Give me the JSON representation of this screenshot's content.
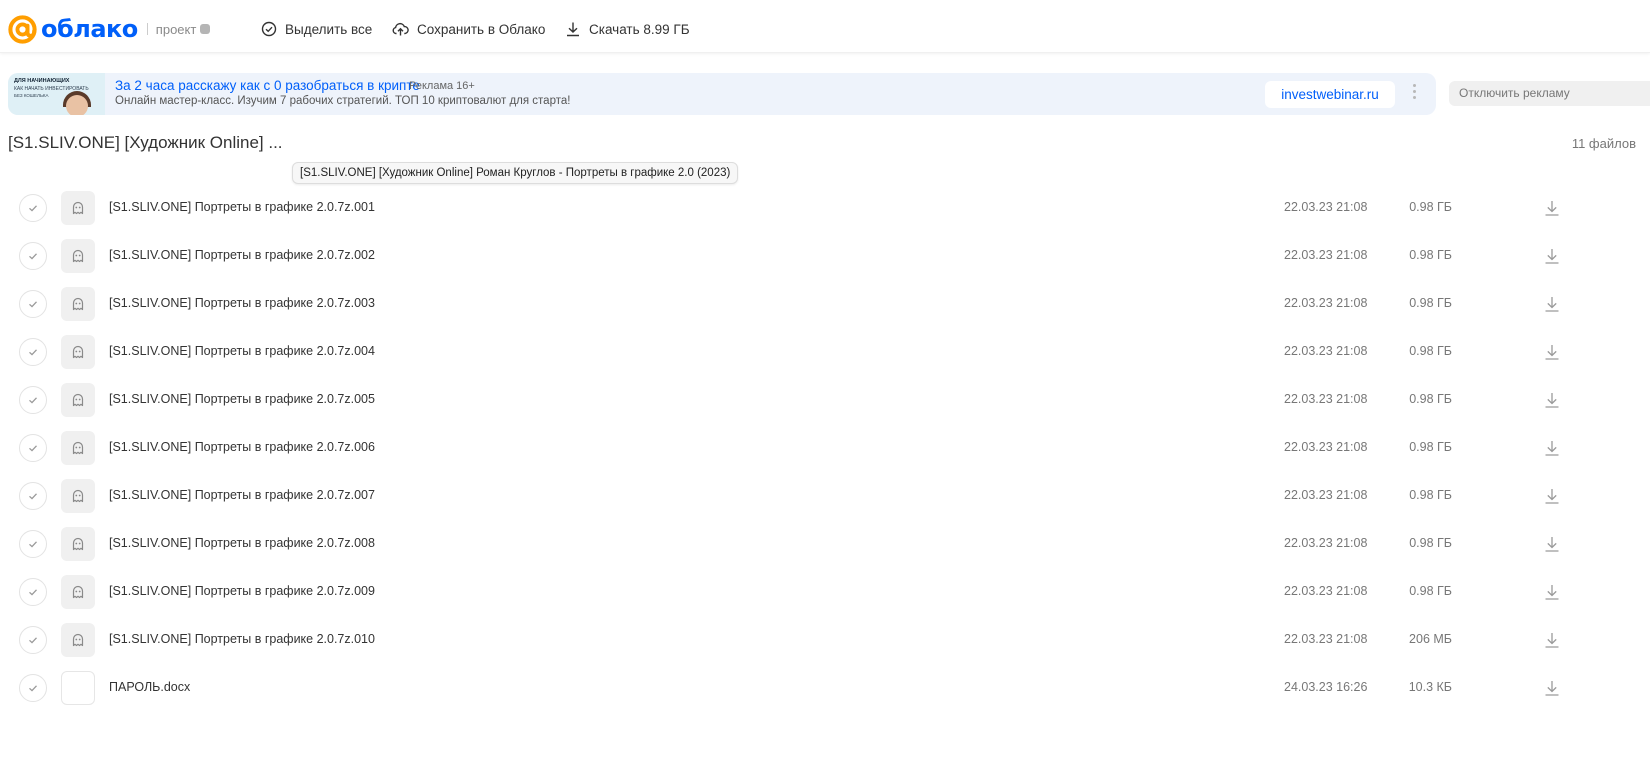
{
  "header": {
    "logo_text": "облако",
    "project_label": "проект",
    "actions": [
      {
        "label": "Выделить все",
        "icon": "check-circle-icon"
      },
      {
        "label": "Сохранить в Облако",
        "icon": "cloud-upload-icon"
      },
      {
        "label": "Скачать 8.99 ГБ",
        "icon": "download-icon"
      }
    ]
  },
  "ad": {
    "thumb_line1": "ДЛЯ НАЧИНАЮЩИХ",
    "thumb_line2": "КАК НАЧАТЬ ИНВЕСТИРОВАТЬ",
    "thumb_line3": "БЕЗ КОШЕЛЬКА",
    "title": "За 2 часа расскажу как с 0 разобраться в крипте",
    "label": "Реклама  16+",
    "description": "Онлайн мастер-класс. Изучим 7 рабочих стратегий. ТОП 10 криптовалют для старта!",
    "link": "investwebinar.ru",
    "disable_label": "Отключить рекламу"
  },
  "folder": {
    "title": "[S1.SLIV.ONE] [Художник Online] ...",
    "tooltip": "[S1.SLIV.ONE] [Художник Online] Роман Круглов - Портреты в графике 2.0 (2023)",
    "file_count": "11 файлов"
  },
  "files": [
    {
      "name": "[S1.SLIV.ONE] Портреты в графике 2.0.7z.001",
      "date": "22.03.23 21:08",
      "size": "0.98 ГБ",
      "type": "archive"
    },
    {
      "name": "[S1.SLIV.ONE] Портреты в графике 2.0.7z.002",
      "date": "22.03.23 21:08",
      "size": "0.98 ГБ",
      "type": "archive"
    },
    {
      "name": "[S1.SLIV.ONE] Портреты в графике 2.0.7z.003",
      "date": "22.03.23 21:08",
      "size": "0.98 ГБ",
      "type": "archive"
    },
    {
      "name": "[S1.SLIV.ONE] Портреты в графике 2.0.7z.004",
      "date": "22.03.23 21:08",
      "size": "0.98 ГБ",
      "type": "archive"
    },
    {
      "name": "[S1.SLIV.ONE] Портреты в графике 2.0.7z.005",
      "date": "22.03.23 21:08",
      "size": "0.98 ГБ",
      "type": "archive"
    },
    {
      "name": "[S1.SLIV.ONE] Портреты в графике 2.0.7z.006",
      "date": "22.03.23 21:08",
      "size": "0.98 ГБ",
      "type": "archive"
    },
    {
      "name": "[S1.SLIV.ONE] Портреты в графике 2.0.7z.007",
      "date": "22.03.23 21:08",
      "size": "0.98 ГБ",
      "type": "archive"
    },
    {
      "name": "[S1.SLIV.ONE] Портреты в графике 2.0.7z.008",
      "date": "22.03.23 21:08",
      "size": "0.98 ГБ",
      "type": "archive"
    },
    {
      "name": "[S1.SLIV.ONE] Портреты в графике 2.0.7z.009",
      "date": "22.03.23 21:08",
      "size": "0.98 ГБ",
      "type": "archive"
    },
    {
      "name": "[S1.SLIV.ONE] Портреты в графике 2.0.7z.010",
      "date": "22.03.23 21:08",
      "size": "206 МБ",
      "type": "archive"
    },
    {
      "name": "ПАРОЛЬ.docx",
      "date": "24.03.23 16:26",
      "size": "10.3 КБ",
      "type": "document"
    }
  ],
  "colors": {
    "brand_blue": "#005ff9",
    "brand_orange": "#ff9e00",
    "ad_background": "#eef3fb"
  }
}
